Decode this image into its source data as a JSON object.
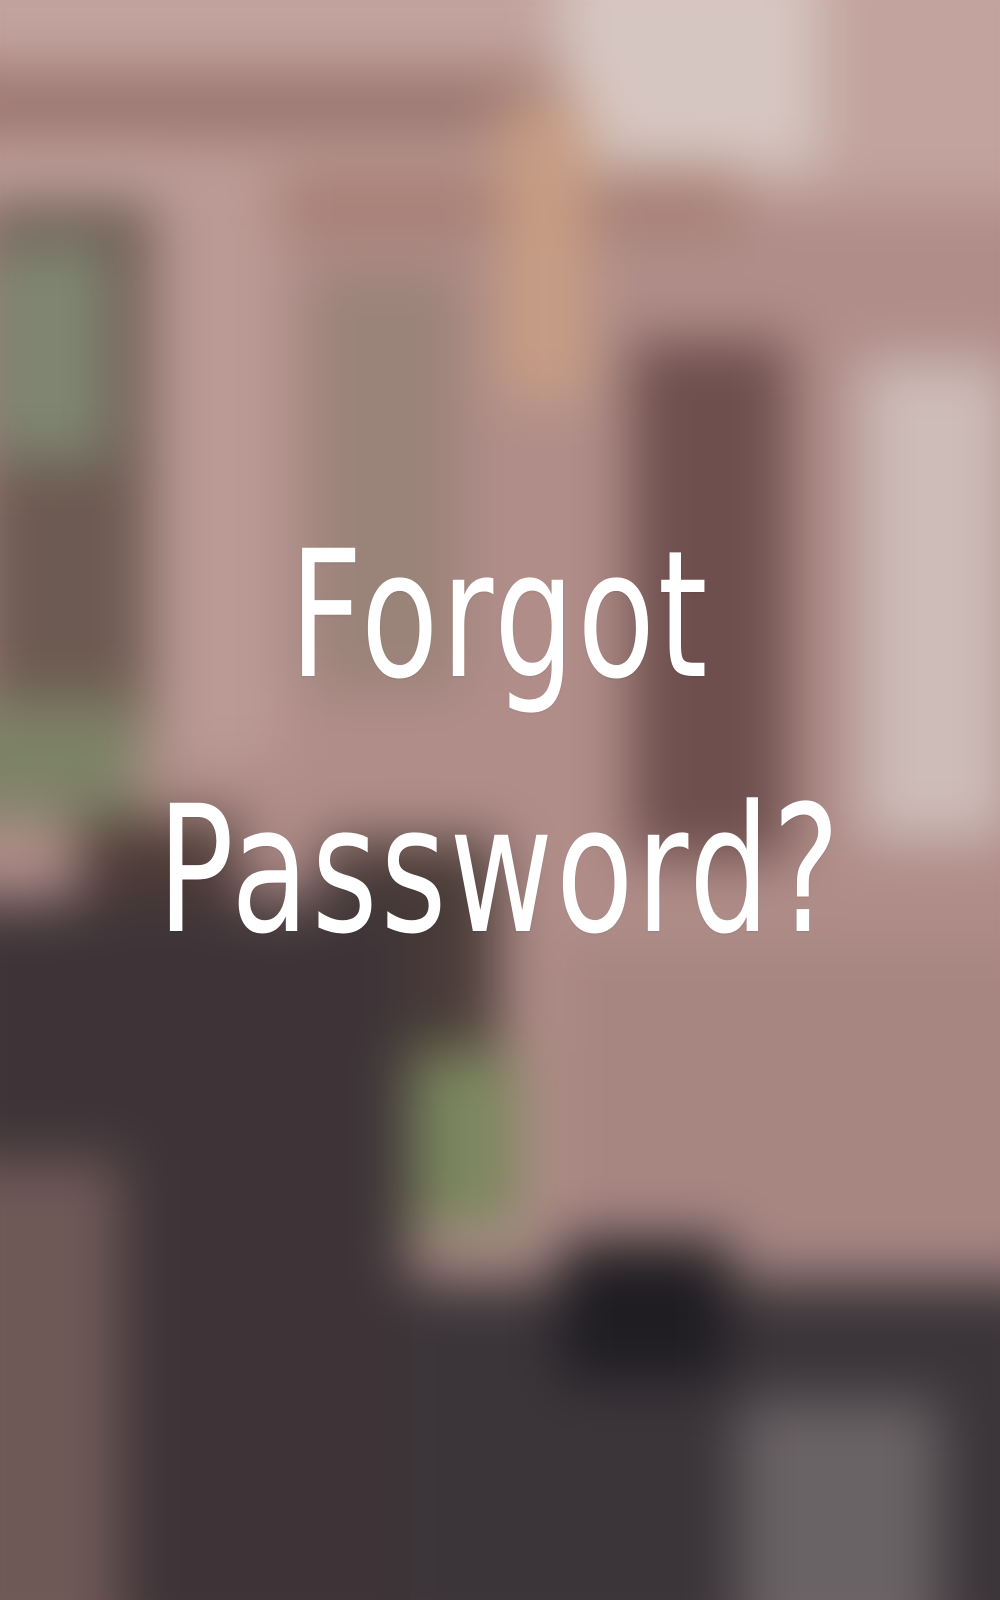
{
  "screen": {
    "title_line_1": "Forgot",
    "title_line_2": "Password?"
  },
  "colors": {
    "title_text": "#ffffff",
    "background_wall": "#b8958f",
    "background_dark": "#3a3136",
    "background_foliage": "#7e8a5e"
  }
}
